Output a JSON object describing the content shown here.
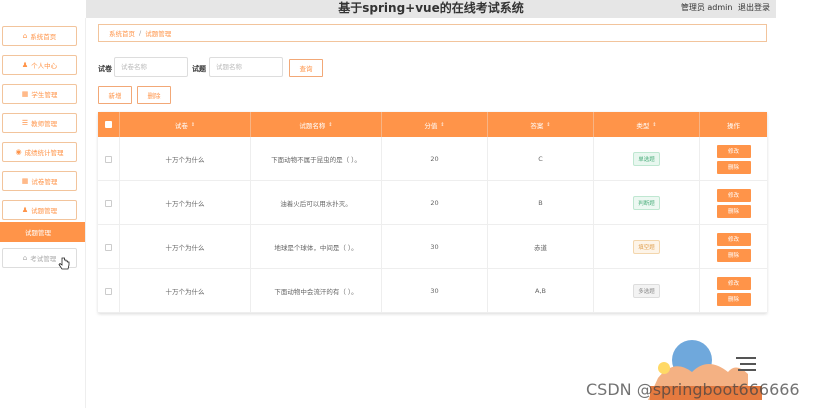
{
  "header": {
    "title": "基于spring+vue的在线考试系统",
    "user_label": "管理员 admin",
    "logout_label": "退出登录"
  },
  "sidebar": {
    "items": [
      {
        "label": "系统首页",
        "icon": "home-icon"
      },
      {
        "label": "个人中心",
        "icon": "user-icon"
      },
      {
        "label": "学生管理",
        "icon": "grid-icon"
      },
      {
        "label": "教师管理",
        "icon": "list-icon"
      },
      {
        "label": "成绩统计管理",
        "icon": "chart-icon"
      },
      {
        "label": "试卷管理",
        "icon": "grid-icon"
      },
      {
        "label": "试题管理",
        "icon": "user-icon"
      },
      {
        "label": "试题管理"
      },
      {
        "label": "考试管理",
        "icon": "exam-icon"
      }
    ]
  },
  "breadcrumb": {
    "home": "系统首页",
    "current": "试题管理"
  },
  "search": {
    "paper_label": "试卷",
    "paper_placeholder": "试卷名称",
    "question_label": "试题",
    "question_placeholder": "试题名称",
    "query_button": "查询"
  },
  "actions": {
    "add_label": "新增",
    "delete_label": "删除"
  },
  "table": {
    "columns": [
      "试卷",
      "试题名称",
      "分值",
      "答案",
      "类型",
      "操作"
    ],
    "rows": [
      {
        "paper": "十万个为什么",
        "question": "下面动物不属于昆虫的是（ ）。",
        "score": "20",
        "answer": "C",
        "type": "单选题",
        "edit": "修改",
        "delete": "删除"
      },
      {
        "paper": "十万个为什么",
        "question": "油着火后可以用水扑灭。",
        "score": "20",
        "answer": "B",
        "type": "判断题",
        "edit": "修改",
        "delete": "删除"
      },
      {
        "paper": "十万个为什么",
        "question": "地球是个球体，中间是（ ）。",
        "score": "30",
        "answer": "赤道",
        "type": "填空题",
        "edit": "修改",
        "delete": "删除"
      },
      {
        "paper": "十万个为什么",
        "question": "下面动物中会流汗的有（ ）。",
        "score": "30",
        "answer": "A,B",
        "type": "多选题",
        "edit": "修改",
        "delete": "删除"
      }
    ]
  },
  "watermark": "CSDN @springboot666666",
  "colors": {
    "accent": "#ff9449",
    "topbar": "#e6e6e6"
  }
}
